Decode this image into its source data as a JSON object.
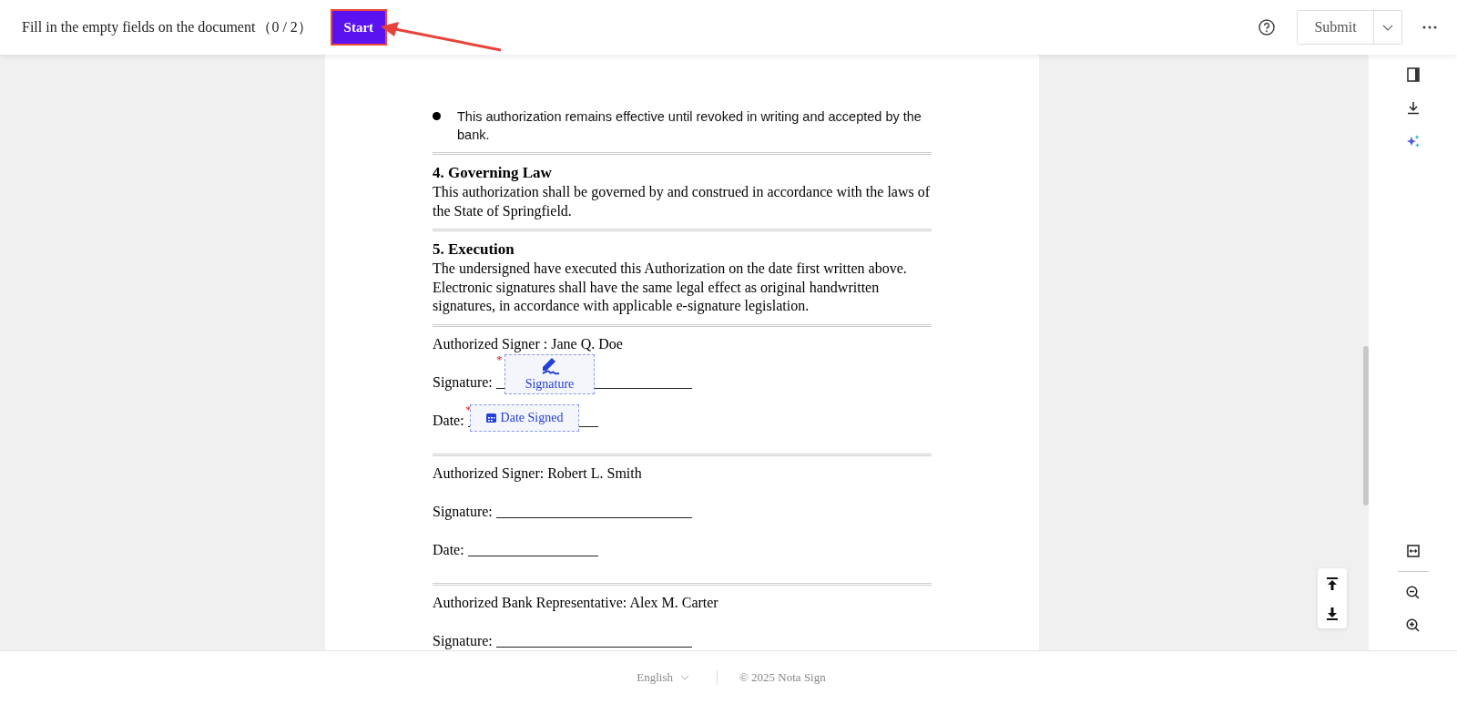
{
  "header": {
    "instruction": "Fill in the empty fields on the document",
    "progress": "（0 / 2）",
    "start_button": "Start",
    "submit_button": "Submit"
  },
  "document": {
    "bullets": [
      "This authorization remains effective until revoked in writing and accepted by the bank."
    ],
    "sections": [
      {
        "heading": "4. Governing Law",
        "body": "This authorization shall be governed by and construed in accordance with the laws of the State of Springfield."
      },
      {
        "heading": "5. Execution",
        "body": "The undersigned have executed this Authorization on the date first written above. Electronic signatures shall have the same legal effect as original handwritten signatures, in accordance with applicable e-signature legislation."
      }
    ],
    "signers": [
      {
        "label": "Authorized Signer : Jane Q. Doe",
        "signature_label": "Signature:",
        "date_label": "Date:",
        "fields": [
          {
            "kind": "signature",
            "label": "Signature",
            "required_mark": "*"
          },
          {
            "kind": "date",
            "label": "Date Signed",
            "required_mark": "*"
          }
        ]
      },
      {
        "label": "Authorized Signer: Robert L. Smith",
        "signature_label": "Signature:",
        "date_label": "Date:"
      },
      {
        "label": "Authorized Bank Representative: Alex M. Carter",
        "signature_label": "Signature:"
      }
    ]
  },
  "footer": {
    "language": "English",
    "copyright": "© 2025 Nota Sign"
  }
}
